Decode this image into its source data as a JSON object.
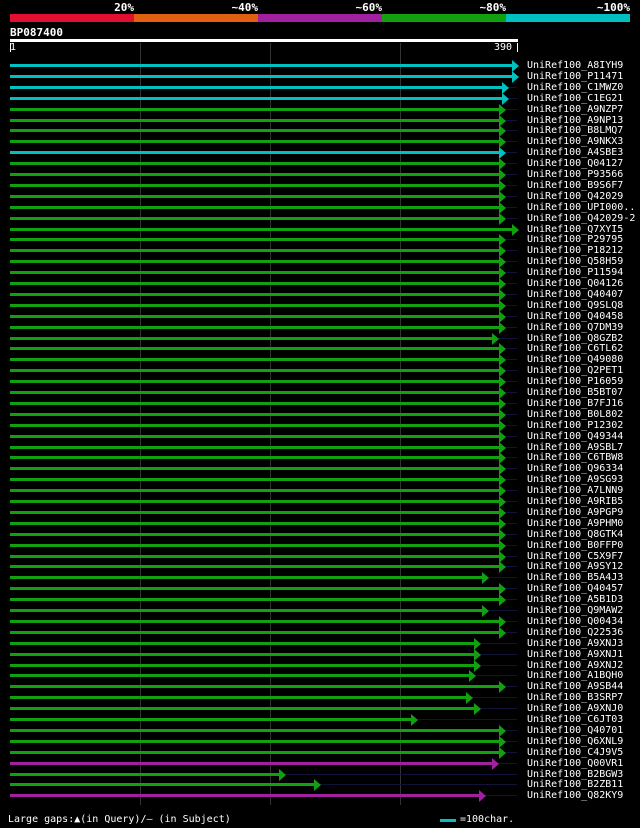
{
  "legend": {
    "labels": [
      "20%",
      "~40%",
      "~60%",
      "~80%",
      "~100%"
    ],
    "colors": [
      "#e0102e",
      "#e06010",
      "#a020a0",
      "#10a010",
      "#00c0c0"
    ]
  },
  "query": {
    "id": "BP087400",
    "start": "1",
    "end": "390"
  },
  "hits": [
    {
      "id": "UniRef100_A8IYH9",
      "color": "#00c0c0",
      "arrow_at": 0.99
    },
    {
      "id": "UniRef100_P11471",
      "color": "#00c0c0",
      "arrow_at": 0.99
    },
    {
      "id": "UniRef100_C1MWZ0",
      "color": "#00c0c0",
      "arrow_at": 0.97
    },
    {
      "id": "UniRef100_C1EG21",
      "color": "#00c0c0",
      "arrow_at": 0.97
    },
    {
      "id": "UniRef100_A9NZP7",
      "color": "#10a010",
      "arrow_at": 0.965
    },
    {
      "id": "UniRef100_A9NP13",
      "color": "#10a010",
      "arrow_at": 0.965
    },
    {
      "id": "UniRef100_B8LMQ7",
      "color": "#10a010",
      "arrow_at": 0.965
    },
    {
      "id": "UniRef100_A9NKX3",
      "color": "#10a010",
      "arrow_at": 0.965
    },
    {
      "id": "UniRef100_A4SBE3",
      "color": "#00c0c0",
      "arrow_at": 0.965
    },
    {
      "id": "UniRef100_Q04127",
      "color": "#10a010",
      "arrow_at": 0.965
    },
    {
      "id": "UniRef100_P93566",
      "color": "#10a010",
      "arrow_at": 0.965
    },
    {
      "id": "UniRef100_B9S6F7",
      "color": "#10a010",
      "arrow_at": 0.965
    },
    {
      "id": "UniRef100_Q42029",
      "color": "#10a010",
      "arrow_at": 0.965
    },
    {
      "id": "UniRef100_UPI000..",
      "color": "#10a010",
      "arrow_at": 0.965
    },
    {
      "id": "UniRef100_Q42029-2",
      "color": "#10a010",
      "arrow_at": 0.965
    },
    {
      "id": "UniRef100_Q7XYI5",
      "color": "#10a010",
      "arrow_at": 0.99
    },
    {
      "id": "UniRef100_P29795",
      "color": "#10a010",
      "arrow_at": 0.965
    },
    {
      "id": "UniRef100_P18212",
      "color": "#10a010",
      "arrow_at": 0.965
    },
    {
      "id": "UniRef100_Q58H59",
      "color": "#10a010",
      "arrow_at": 0.965
    },
    {
      "id": "UniRef100_P11594",
      "color": "#10a010",
      "arrow_at": 0.965
    },
    {
      "id": "UniRef100_Q04126",
      "color": "#10a010",
      "arrow_at": 0.965
    },
    {
      "id": "UniRef100_Q40407",
      "color": "#10a010",
      "arrow_at": 0.965
    },
    {
      "id": "UniRef100_Q9SLQ8",
      "color": "#10a010",
      "arrow_at": 0.965
    },
    {
      "id": "UniRef100_Q40458",
      "color": "#10a010",
      "arrow_at": 0.965
    },
    {
      "id": "UniRef100_Q7DM39",
      "color": "#10a010",
      "arrow_at": 0.965
    },
    {
      "id": "UniRef100_Q8GZB2",
      "color": "#10a010",
      "arrow_at": 0.95
    },
    {
      "id": "UniRef100_C6TL62",
      "color": "#10a010",
      "arrow_at": 0.965
    },
    {
      "id": "UniRef100_Q49080",
      "color": "#10a010",
      "arrow_at": 0.965
    },
    {
      "id": "UniRef100_Q2PET1",
      "color": "#10a010",
      "arrow_at": 0.965
    },
    {
      "id": "UniRef100_P16059",
      "color": "#10a010",
      "arrow_at": 0.965
    },
    {
      "id": "UniRef100_B5BT07",
      "color": "#10a010",
      "arrow_at": 0.965
    },
    {
      "id": "UniRef100_B7FJ16",
      "color": "#10a010",
      "arrow_at": 0.965
    },
    {
      "id": "UniRef100_B0L802",
      "color": "#10a010",
      "arrow_at": 0.965
    },
    {
      "id": "UniRef100_P12302",
      "color": "#10a010",
      "arrow_at": 0.965
    },
    {
      "id": "UniRef100_Q49344",
      "color": "#10a010",
      "arrow_at": 0.965
    },
    {
      "id": "UniRef100_A9SBL7",
      "color": "#10a010",
      "arrow_at": 0.965
    },
    {
      "id": "UniRef100_C6TBW8",
      "color": "#10a010",
      "arrow_at": 0.965
    },
    {
      "id": "UniRef100_Q96334",
      "color": "#10a010",
      "arrow_at": 0.965
    },
    {
      "id": "UniRef100_A9SG93",
      "color": "#10a010",
      "arrow_at": 0.965
    },
    {
      "id": "UniRef100_A7LNN9",
      "color": "#10a010",
      "arrow_at": 0.965
    },
    {
      "id": "UniRef100_A9RIB5",
      "color": "#10a010",
      "arrow_at": 0.965
    },
    {
      "id": "UniRef100_A9PGP9",
      "color": "#10a010",
      "arrow_at": 0.965
    },
    {
      "id": "UniRef100_A9PHM0",
      "color": "#10a010",
      "arrow_at": 0.965
    },
    {
      "id": "UniRef100_Q8GTK4",
      "color": "#10a010",
      "arrow_at": 0.965
    },
    {
      "id": "UniRef100_B0FFP0",
      "color": "#10a010",
      "arrow_at": 0.965
    },
    {
      "id": "UniRef100_C5X9F7",
      "color": "#10a010",
      "arrow_at": 0.965
    },
    {
      "id": "UniRef100_A9SY12",
      "color": "#10a010",
      "arrow_at": 0.965
    },
    {
      "id": "UniRef100_B5A4J3",
      "color": "#10a010",
      "arrow_at": 0.93
    },
    {
      "id": "UniRef100_Q40457",
      "color": "#10a010",
      "arrow_at": 0.965
    },
    {
      "id": "UniRef100_A5B1D3",
      "color": "#10a010",
      "arrow_at": 0.965
    },
    {
      "id": "UniRef100_Q9MAW2",
      "color": "#10a010",
      "arrow_at": 0.93
    },
    {
      "id": "UniRef100_Q00434",
      "color": "#10a010",
      "arrow_at": 0.965
    },
    {
      "id": "UniRef100_Q22536",
      "color": "#10a010",
      "arrow_at": 0.965
    },
    {
      "id": "UniRef100_A9XNJ3",
      "color": "#10a010",
      "arrow_at": 0.915
    },
    {
      "id": "UniRef100_A9XNJ1",
      "color": "#10a010",
      "arrow_at": 0.915
    },
    {
      "id": "UniRef100_A9XNJ2",
      "color": "#10a010",
      "arrow_at": 0.915
    },
    {
      "id": "UniRef100_A1BQH0",
      "color": "#10a010",
      "arrow_at": 0.905
    },
    {
      "id": "UniRef100_A9SB44",
      "color": "#10a010",
      "arrow_at": 0.965
    },
    {
      "id": "UniRef100_B3SRP7",
      "color": "#10a010",
      "arrow_at": 0.9
    },
    {
      "id": "UniRef100_A9XNJ0",
      "color": "#10a010",
      "arrow_at": 0.915
    },
    {
      "id": "UniRef100_C6JT03",
      "color": "#10a010",
      "arrow_at": 0.79
    },
    {
      "id": "UniRef100_Q40701",
      "color": "#10a010",
      "arrow_at": 0.965
    },
    {
      "id": "UniRef100_Q6XNL9",
      "color": "#10a010",
      "arrow_at": 0.965
    },
    {
      "id": "UniRef100_C4J9V5",
      "color": "#10a010",
      "arrow_at": 0.965
    },
    {
      "id": "UniRef100_Q00VR1",
      "color": "#a020a0",
      "arrow_at": 0.95
    },
    {
      "id": "UniRef100_B2BGW3",
      "color": "#10a010",
      "arrow_at": 0.53
    },
    {
      "id": "UniRef100_B2ZB11",
      "color": "#10a010",
      "arrow_at": 0.6
    },
    {
      "id": "UniRef100_Q82KY9",
      "color": "#a020a0",
      "arrow_at": 0.925
    }
  ],
  "footer": {
    "gaps_label": "Large gaps:▲(in Query)/– (in Subject)",
    "scale_label": "=100char."
  }
}
